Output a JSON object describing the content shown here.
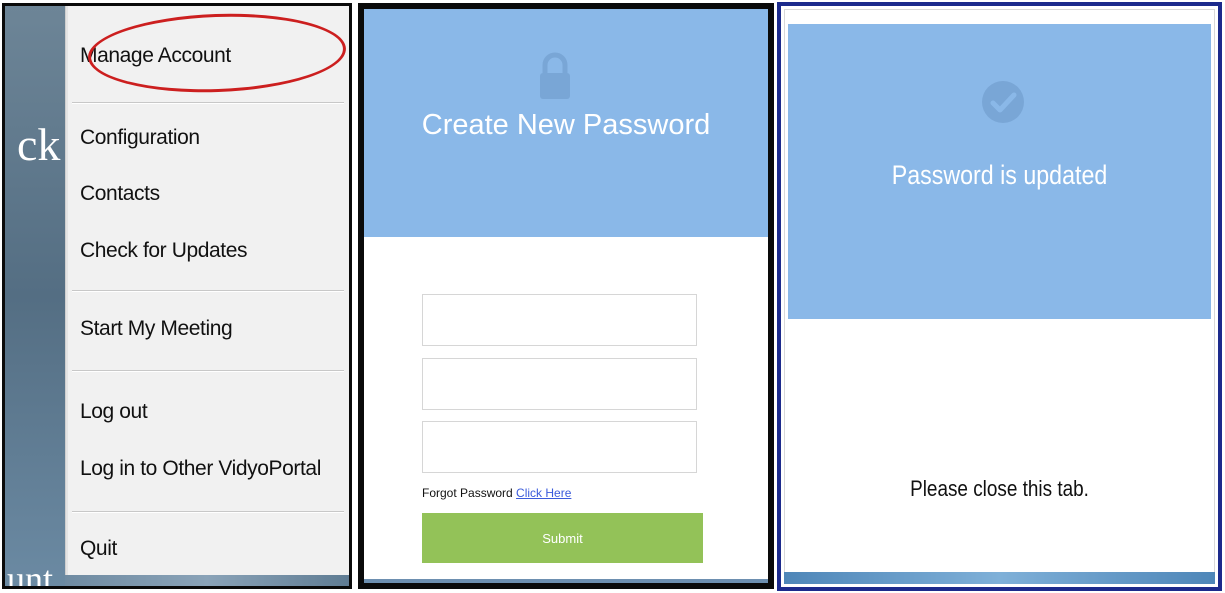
{
  "menu": {
    "background_fragments": {
      "top": "ck",
      "bottom": "unt"
    },
    "items": [
      {
        "label": "Manage Account",
        "highlighted": true
      },
      {
        "label": "Configuration"
      },
      {
        "label": "Contacts"
      },
      {
        "label": "Check for Updates"
      },
      {
        "label": "Start My Meeting"
      },
      {
        "label": "Log out"
      },
      {
        "label": "Log in to Other VidyoPortal"
      },
      {
        "label": "Quit"
      }
    ],
    "highlight_color": "#cc1f1f"
  },
  "create_password": {
    "icon": "lock-icon",
    "title": "Create New Password",
    "fields": [
      {
        "value": "",
        "type": "password"
      },
      {
        "value": "",
        "type": "password"
      },
      {
        "value": "",
        "type": "password"
      }
    ],
    "forgot_text": "Forgot Password",
    "forgot_link": "Click Here",
    "submit_label": "Submit",
    "header_color": "#8ab8e8",
    "submit_color": "#93c258"
  },
  "password_updated": {
    "icon": "check-circle-icon",
    "title": "Password is updated",
    "message": "Please close this tab.",
    "header_color": "#8ab8e8"
  }
}
